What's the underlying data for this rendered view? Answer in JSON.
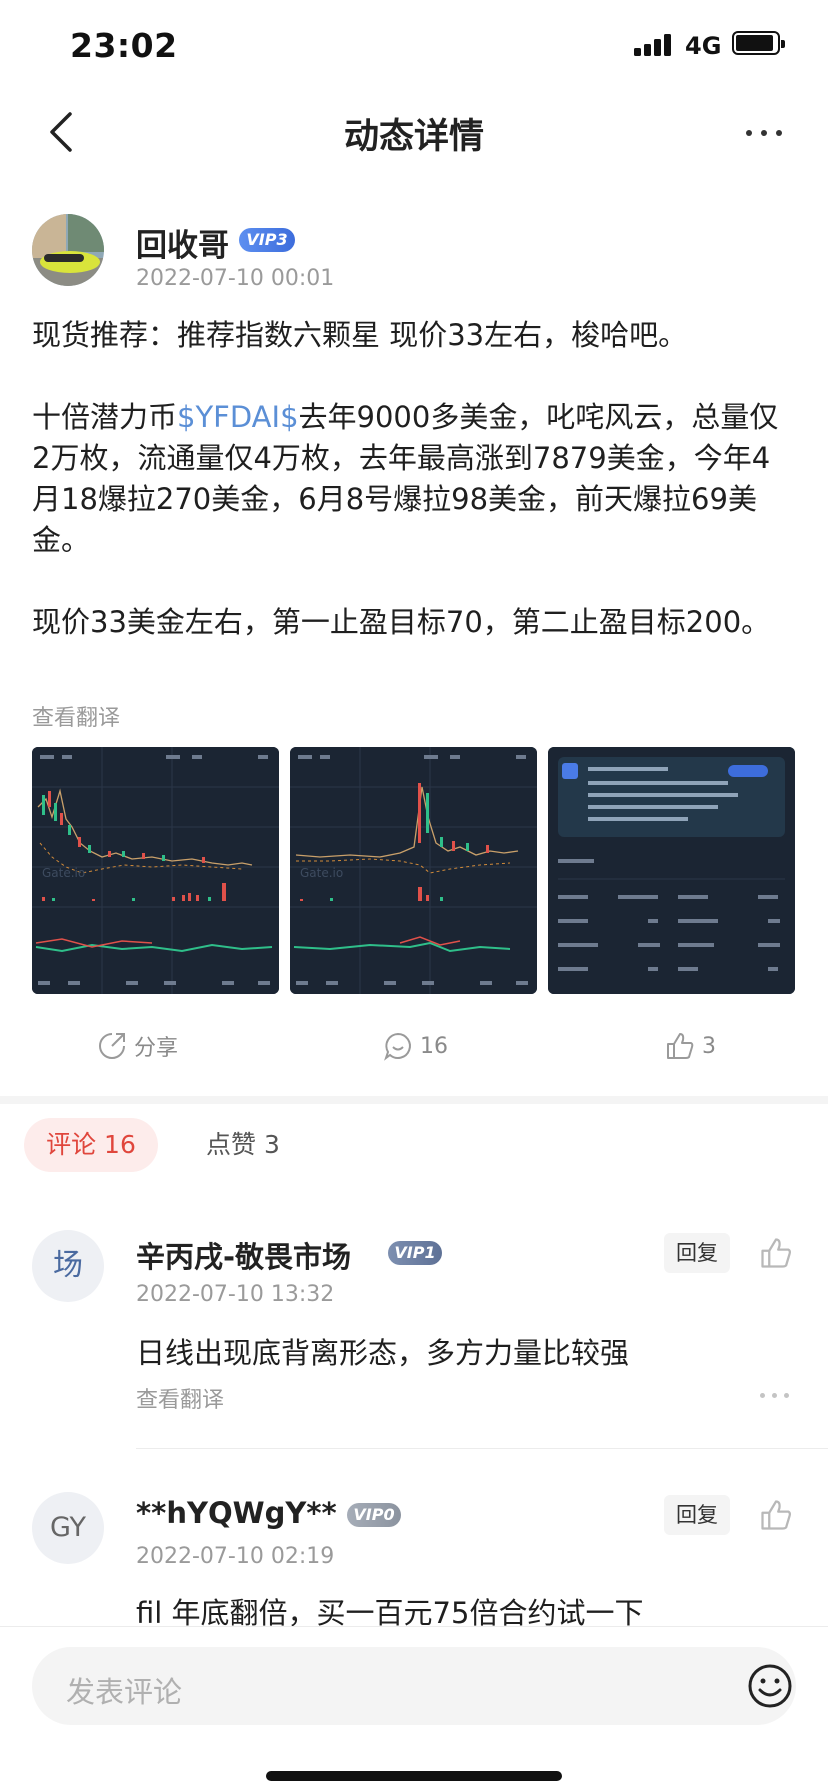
{
  "status_bar": {
    "time": "23:02",
    "network": "4G"
  },
  "nav": {
    "title": "动态详情"
  },
  "post": {
    "author_name": "回收哥",
    "author_vip": "VIP3",
    "timestamp": "2022-07-10 00:01",
    "paragraphs": [
      "现货推荐：推荐指数六颗星 现价33左右，梭哈吧。",
      "",
      "十倍潜力币",
      "去年9000多美金，叱咤风云，总量仅2万枚，流通量仅4万枚，去年最高涨到7879美金，今年4月18爆拉270美金，6月8号爆拉98美金，前天爆拉69美金。",
      "",
      "现价33美金左右，第一止盈目标70，第二止盈目标200。"
    ],
    "tag": "$YFDAI$",
    "translate_label": "查看翻译",
    "images": [
      {
        "watermark": "Gate.io"
      },
      {
        "watermark": "Gate.io"
      },
      {
        "kind": "detail-screenshot"
      }
    ]
  },
  "actions": {
    "share_label": "分享",
    "comment_count": "16",
    "like_count": "3"
  },
  "tabs": {
    "comments_label": "评论 16",
    "likes_label": "点赞 3"
  },
  "comments": [
    {
      "avatar_text": "场",
      "name": "辛丙戌-敬畏市场",
      "vip": "VIP1",
      "time": "2022-07-10 13:32",
      "text": "日线出现底背离形态，多方力量比较强",
      "translate_label": "查看翻译",
      "reply_label": "回复"
    },
    {
      "avatar_text": "GY",
      "name": "**hYQWgY**",
      "vip": "VIP0",
      "time": "2022-07-10 02:19",
      "text": "fil 年底翻倍，买一百元75倍合约试一下",
      "reply_label": "回复"
    }
  ],
  "input": {
    "placeholder": "发表评论"
  },
  "colors": {
    "accent_red": "#e0463c",
    "tag_blue": "#5b8fd6",
    "vip3": "#4a7be6",
    "chart_bg": "#1b2533"
  }
}
